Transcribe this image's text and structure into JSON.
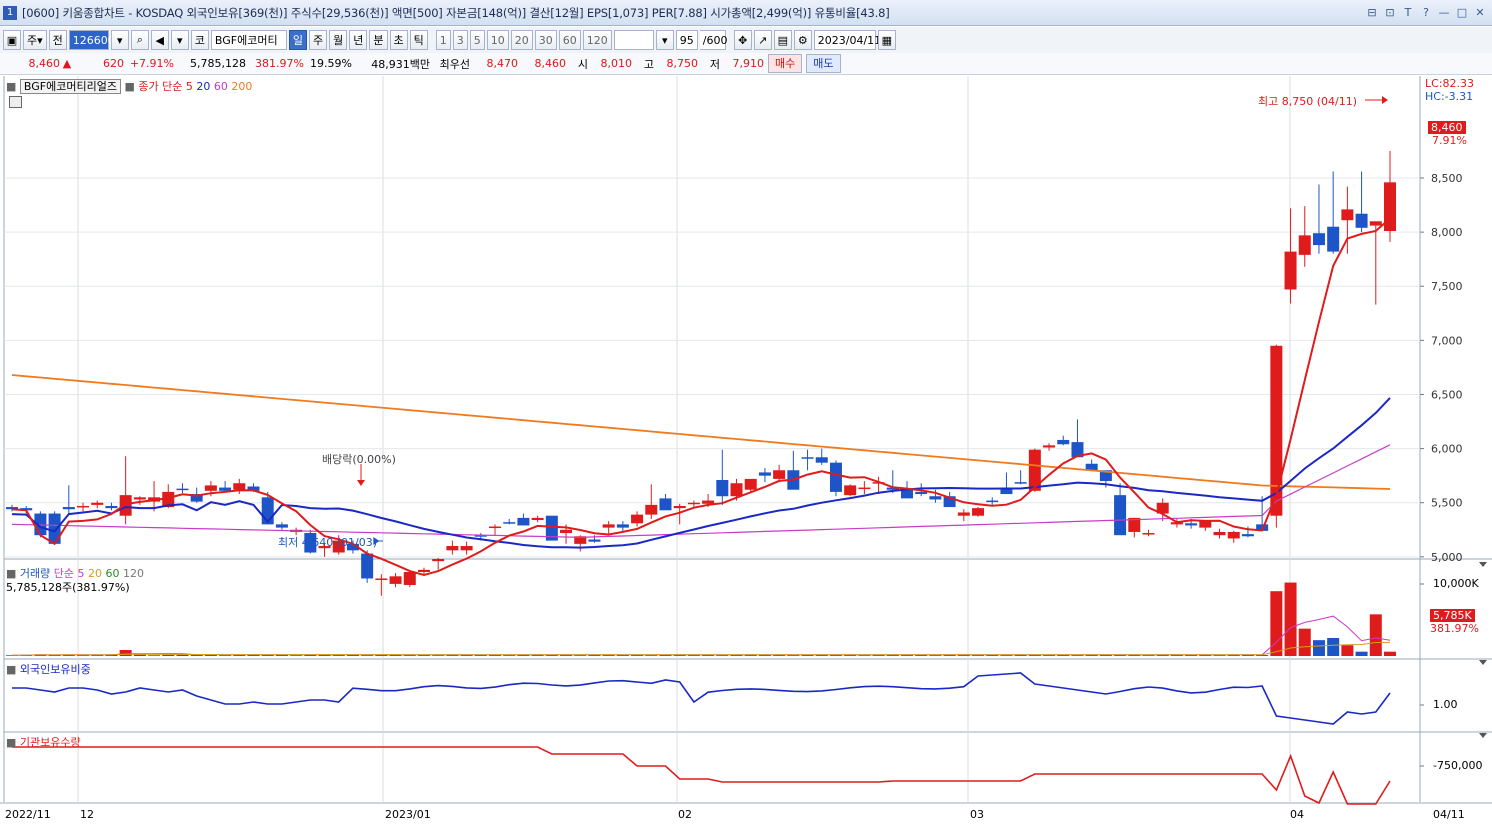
{
  "window": {
    "number": "1",
    "title": "[0600] 키움종합차트 - KOSDAQ 외국인보유[369(천)] 주식수[29,536(천)] 액면[500] 자본금[148(억)] 결산[12월] EPS[1,073] PER[7.88] 시가총액[2,499(억)] 유통비율[43.8]",
    "buttons": [
      "⊟",
      "⊡",
      "T",
      "?",
      "—",
      "□",
      "✕"
    ]
  },
  "toolbar": {
    "period_select": "주",
    "mode_select": "전",
    "code": "126600",
    "market_btn": "코",
    "name": "BGF에코머티",
    "tabs": [
      "일",
      "주",
      "월",
      "년",
      "분",
      "초",
      "틱"
    ],
    "active_tab": "일",
    "intervals": [
      "1",
      "3",
      "5",
      "10",
      "20",
      "30",
      "60",
      "120"
    ],
    "count": "95",
    "count_total": "/600",
    "date": "2023/04/11"
  },
  "quote": {
    "price": "8,460",
    "change": "620",
    "change_pct": "+7.91%",
    "volume": "5,785,128",
    "volume_ratio": "381.97%",
    "turnover": "19.59%",
    "amount": "48,931백만",
    "best_label": "최우선",
    "ask": "8,470",
    "bid": "8,460",
    "open_label": "시",
    "open": "8,010",
    "high_label": "고",
    "high": "8,750",
    "low_label": "저",
    "low": "7,910",
    "buy_label": "매수",
    "sell_label": "매도"
  },
  "chart_legend": {
    "stock_name": "BGF에코머티리얼즈",
    "ma_label": "종가 단순",
    "ma_periods": [
      "5",
      "20",
      "60",
      "200"
    ],
    "lc": "LC:82.33",
    "hc": "HC:-3.31",
    "cur_price": "8,460",
    "cur_pct": "7.91%",
    "high_note": "최고 8,750 (04/11)",
    "low_note": "최저 4,640 (01/03)",
    "dividend_note": "배당락(0.00%)"
  },
  "volume_panel": {
    "title": "거래량",
    "ma_label": "단순",
    "ma_periods": [
      "5",
      "20",
      "60",
      "120"
    ],
    "value_text": "5,785,128주(381.97%)",
    "cur": "5,785K",
    "cur_pct": "381.97%",
    "axis_label": "10,000K"
  },
  "foreign_panel": {
    "title": "외국인보유비중",
    "axis_label": "1.00"
  },
  "inst_panel": {
    "title": "기관보유수량",
    "axis_label": "-750,000"
  },
  "x_axis": [
    "2022/11",
    "12",
    "2023/01",
    "02",
    "03",
    "04",
    "04/11"
  ],
  "colors": {
    "up": "#e01b1b",
    "down": "#1d55c8",
    "ma5": "#e01b1b",
    "ma20": "#1a28c6",
    "ma60": "#c83cc8",
    "ma200": "#f07a1e"
  },
  "chart_data": {
    "type": "candlestick",
    "y_ticks": [
      "8,500",
      "8,000",
      "7,500",
      "7,000",
      "6,500",
      "6,000",
      "5,500",
      "5,000"
    ],
    "ohlc": [
      [
        5460,
        5480,
        5420,
        5440
      ],
      [
        5450,
        5470,
        5400,
        5430
      ],
      [
        5400,
        5420,
        5180,
        5200
      ],
      [
        5400,
        5420,
        5140,
        5120
      ],
      [
        5460,
        5660,
        5400,
        5440
      ],
      [
        5460,
        5500,
        5420,
        5470
      ],
      [
        5480,
        5520,
        5450,
        5500
      ],
      [
        5470,
        5500,
        5430,
        5450
      ],
      [
        5380,
        5930,
        5300,
        5570
      ],
      [
        5530,
        5560,
        5480,
        5550
      ],
      [
        5510,
        5700,
        5420,
        5550
      ],
      [
        5460,
        5670,
        5450,
        5600
      ],
      [
        5630,
        5680,
        5590,
        5620
      ],
      [
        5580,
        5640,
        5500,
        5510
      ],
      [
        5610,
        5700,
        5560,
        5660
      ],
      [
        5640,
        5700,
        5600,
        5610
      ],
      [
        5620,
        5720,
        5580,
        5680
      ],
      [
        5650,
        5680,
        5600,
        5610
      ],
      [
        5550,
        5600,
        5300,
        5300
      ],
      [
        5300,
        5320,
        5250,
        5270
      ],
      [
        5230,
        5270,
        5200,
        5250
      ],
      [
        5220,
        5250,
        5030,
        5040
      ],
      [
        5080,
        5130,
        5000,
        5100
      ],
      [
        5040,
        5200,
        5020,
        5150
      ],
      [
        5120,
        5150,
        5030,
        5060
      ],
      [
        5030,
        5060,
        4760,
        4800
      ],
      [
        4790,
        4840,
        4640,
        4800
      ],
      [
        4750,
        4850,
        4720,
        4820
      ],
      [
        4740,
        4850,
        4720,
        4860
      ],
      [
        4860,
        4900,
        4830,
        4880
      ],
      [
        4960,
        4990,
        4880,
        4980
      ],
      [
        5060,
        5150,
        5020,
        5100
      ],
      [
        5060,
        5140,
        5020,
        5100
      ],
      [
        5200,
        5220,
        5150,
        5190
      ],
      [
        5270,
        5300,
        5200,
        5280
      ],
      [
        5320,
        5350,
        5300,
        5310
      ],
      [
        5360,
        5400,
        5300,
        5290
      ],
      [
        5340,
        5380,
        5320,
        5360
      ],
      [
        5380,
        5360,
        5230,
        5150
      ],
      [
        5220,
        5300,
        5120,
        5250
      ],
      [
        5120,
        5200,
        5050,
        5190
      ],
      [
        5160,
        5200,
        5130,
        5140
      ],
      [
        5270,
        5330,
        5200,
        5300
      ],
      [
        5300,
        5330,
        5240,
        5270
      ],
      [
        5310,
        5420,
        5280,
        5390
      ],
      [
        5390,
        5670,
        5350,
        5480
      ],
      [
        5540,
        5580,
        5450,
        5430
      ],
      [
        5450,
        5490,
        5300,
        5470
      ],
      [
        5490,
        5520,
        5450,
        5500
      ],
      [
        5490,
        5580,
        5460,
        5520
      ],
      [
        5710,
        5990,
        5480,
        5560
      ],
      [
        5560,
        5720,
        5520,
        5680
      ],
      [
        5620,
        5710,
        5600,
        5720
      ],
      [
        5780,
        5820,
        5690,
        5750
      ],
      [
        5720,
        5850,
        5690,
        5800
      ],
      [
        5800,
        5980,
        5700,
        5620
      ],
      [
        5920,
        5990,
        5800,
        5910
      ],
      [
        5920,
        6000,
        5850,
        5870
      ],
      [
        5870,
        5890,
        5560,
        5600
      ],
      [
        5570,
        5670,
        5560,
        5660
      ],
      [
        5630,
        5700,
        5580,
        5640
      ],
      [
        5690,
        5740,
        5580,
        5690
      ],
      [
        5640,
        5800,
        5590,
        5620
      ],
      [
        5620,
        5700,
        5580,
        5540
      ],
      [
        5600,
        5680,
        5560,
        5580
      ],
      [
        5560,
        5620,
        5500,
        5530
      ],
      [
        5560,
        5600,
        5460,
        5460
      ],
      [
        5380,
        5440,
        5330,
        5410
      ],
      [
        5380,
        5460,
        5370,
        5450
      ],
      [
        5520,
        5550,
        5480,
        5510
      ],
      [
        5640,
        5780,
        5600,
        5580
      ],
      [
        5690,
        5800,
        5670,
        5680
      ],
      [
        5610,
        6000,
        5600,
        5990
      ],
      [
        6010,
        6050,
        5980,
        6030
      ],
      [
        6080,
        6120,
        6030,
        6040
      ],
      [
        6060,
        6270,
        5940,
        5920
      ],
      [
        5860,
        5900,
        5790,
        5800
      ],
      [
        5800,
        5760,
        5640,
        5700
      ],
      [
        5570,
        5680,
        5520,
        5200
      ],
      [
        5230,
        5310,
        5180,
        5360
      ],
      [
        5210,
        5250,
        5190,
        5220
      ],
      [
        5400,
        5540,
        5330,
        5500
      ],
      [
        5300,
        5350,
        5270,
        5320
      ],
      [
        5310,
        5350,
        5260,
        5290
      ],
      [
        5270,
        5300,
        5240,
        5330
      ],
      [
        5200,
        5260,
        5170,
        5230
      ],
      [
        5170,
        5240,
        5130,
        5230
      ],
      [
        5210,
        5280,
        5180,
        5190
      ],
      [
        5300,
        5560,
        5250,
        5240
      ],
      [
        5380,
        6960,
        5270,
        6950
      ],
      [
        7470,
        8220,
        7340,
        7820
      ],
      [
        7790,
        8240,
        7680,
        7970
      ],
      [
        7990,
        8440,
        7800,
        7880
      ],
      [
        8050,
        8560,
        7800,
        7820
      ],
      [
        8110,
        8420,
        7800,
        8210
      ],
      [
        8170,
        8560,
        8000,
        8040
      ],
      [
        8060,
        8060,
        7330,
        8100
      ],
      [
        8010,
        8750,
        7910,
        8460
      ]
    ]
  }
}
